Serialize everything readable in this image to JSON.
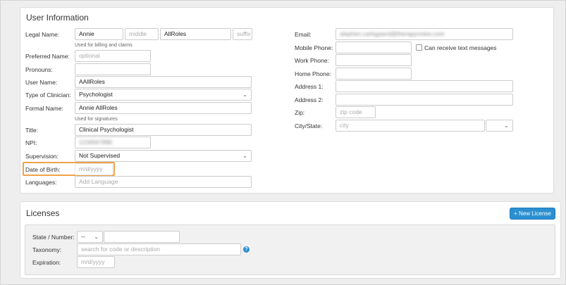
{
  "user_info": {
    "title": "User Information",
    "legal_name": {
      "label": "Legal Name:",
      "first": "Annie",
      "middle_placeholder": "middle",
      "last": "AllRoles",
      "suffix_placeholder": "suffix",
      "hint": "Used for billing and claims"
    },
    "preferred_name": {
      "label": "Preferred Name:",
      "placeholder": "optional"
    },
    "pronouns": {
      "label": "Pronouns:",
      "value": ""
    },
    "user_name": {
      "label": "User Name:",
      "value": "AAllRoles"
    },
    "type_of_clinician": {
      "label": "Type of Clinician:",
      "value": "Psychologist"
    },
    "formal_name": {
      "label": "Formal Name:",
      "value": "Annie AllRoles",
      "hint": "Used for signatures"
    },
    "title_field": {
      "label": "Title:",
      "value": "Clinical Psychologist"
    },
    "npi": {
      "label": "NPI:",
      "value": "1234567890"
    },
    "supervision": {
      "label": "Supervision:",
      "value": "Not Supervised"
    },
    "date_of_birth": {
      "label": "Date of Birth:",
      "placeholder": "m/d/yyyy"
    },
    "languages": {
      "label": "Languages:",
      "placeholder": "Add Language"
    },
    "email": {
      "label": "Email:",
      "value": "stephen.carlsgaard@therapynotes.com"
    },
    "mobile_phone": {
      "label": "Mobile Phone:",
      "value": "",
      "sms_label": "Can receive text messages"
    },
    "work_phone": {
      "label": "Work Phone:",
      "value": ""
    },
    "home_phone": {
      "label": "Home Phone:",
      "value": ""
    },
    "address1": {
      "label": "Address 1:",
      "value": ""
    },
    "address2": {
      "label": "Address 2:",
      "value": ""
    },
    "zip": {
      "label": "Zip:",
      "placeholder": "zip code"
    },
    "city_state": {
      "label": "City/State:",
      "city_placeholder": "city"
    }
  },
  "licenses": {
    "title": "Licenses",
    "new_button": "+ New License",
    "state_number": {
      "label": "State / Number:",
      "state_value": "--"
    },
    "taxonomy": {
      "label": "Taxonomy:",
      "placeholder": "search for code or description",
      "help": "?"
    },
    "expiration": {
      "label": "Expiration:",
      "placeholder": "m/d/yyyy"
    }
  },
  "colors": {
    "accent": "#2b8fd1",
    "highlight": "#f0a24a"
  }
}
